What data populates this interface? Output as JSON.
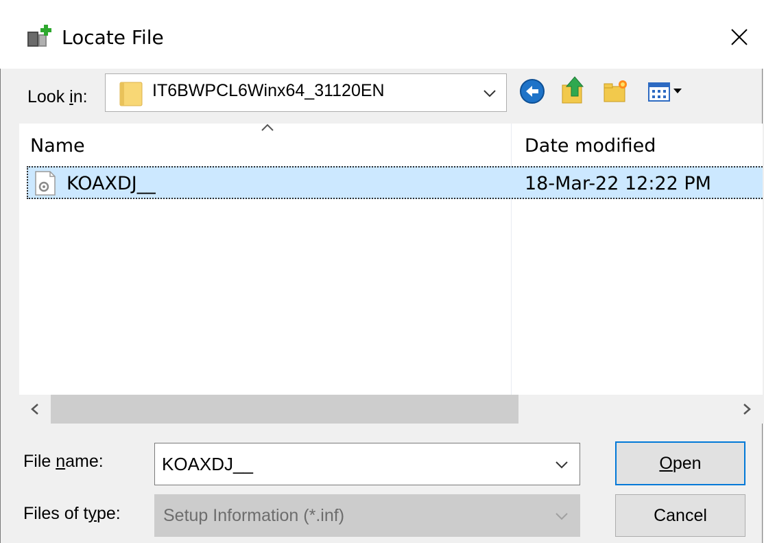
{
  "window": {
    "title": "Locate File",
    "title_icon": "add-hardware-icon",
    "close_icon": "close-icon"
  },
  "lookin": {
    "label_pre": "Look ",
    "label_accel": "i",
    "label_post": "n:",
    "value": "IT6BWPCL6Winx64_31120EN",
    "folder_icon": "folder-icon"
  },
  "toolbar": {
    "back_icon": "back-icon",
    "up_icon": "up-folder-icon",
    "new_folder_icon": "new-folder-icon",
    "view_menu_icon": "view-menu-icon"
  },
  "filelist": {
    "columns": [
      "Name",
      "Date modified"
    ],
    "sort_column": "Name",
    "rows": [
      {
        "name": "KOAXDJ__",
        "date": "18-Mar-22 12:22 PM",
        "icon": "setup-file-icon",
        "selected": true
      }
    ]
  },
  "filename": {
    "label_pre": "File ",
    "label_accel": "n",
    "label_post": "ame:",
    "value": "KOAXDJ__"
  },
  "filetype": {
    "label_pre": "Files of t",
    "label_accel": "y",
    "label_post": "pe:",
    "value": "Setup Information (*.inf)",
    "disabled": true
  },
  "buttons": {
    "open_accel": "O",
    "open_post": "pen",
    "cancel": "Cancel"
  },
  "colors": {
    "selection": "#cce8ff",
    "focus_border": "#0078d7",
    "back_button": "#1e73c8"
  }
}
